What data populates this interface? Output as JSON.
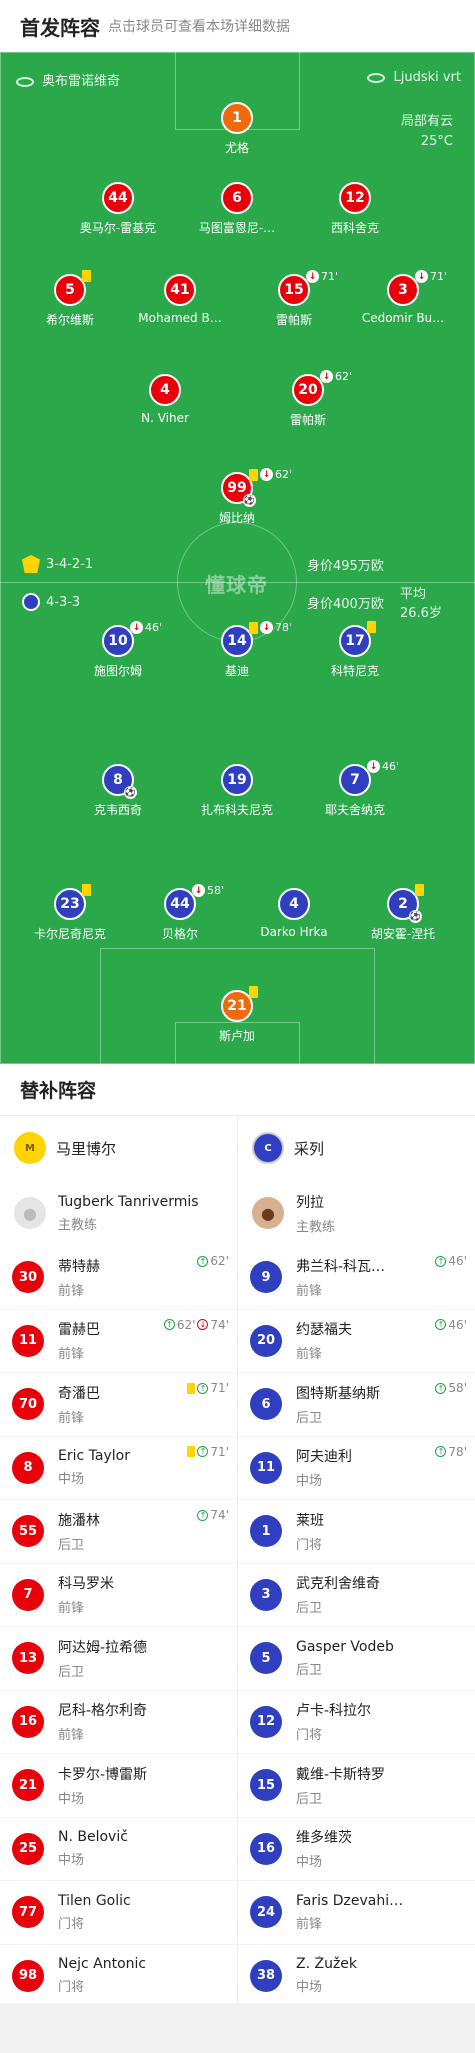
{
  "header": {
    "title": "首发阵容",
    "subtitle": "点击球员可查看本场详细数据"
  },
  "venue": {
    "home": "奥布雷诺维奇",
    "away": "Ljudski vrt"
  },
  "weather": {
    "desc": "局部有云",
    "temp": "25°C"
  },
  "watermark": "懂球帝",
  "home_team_row": {
    "formation": "3-4-2-1",
    "value": "身价495万欧"
  },
  "away_team_row": {
    "formation": "4-3-3",
    "value": "身价400万欧",
    "avg_age": "平均26.6岁"
  },
  "home_players": [
    {
      "num": "1",
      "name": "尤格",
      "color": "orange"
    },
    {
      "num": "44",
      "name": "奥马尔-雷基克",
      "color": "red"
    },
    {
      "num": "6",
      "name": "马图富恩尼-…",
      "color": "red"
    },
    {
      "num": "12",
      "name": "西科舍克",
      "color": "red"
    },
    {
      "num": "5",
      "name": "希尔维斯",
      "color": "red",
      "ev": {
        "yellow": true
      }
    },
    {
      "num": "41",
      "name": "Mohamed B…",
      "color": "red"
    },
    {
      "num": "15",
      "name": "雷帕斯",
      "color": "red",
      "ev": {
        "out": true,
        "min": "71'"
      }
    },
    {
      "num": "3",
      "name": "Cedomir Bu…",
      "color": "red",
      "ev": {
        "out": true,
        "min": "71'"
      }
    },
    {
      "num": "4",
      "name": "N. Viher",
      "color": "red"
    },
    {
      "num": "20",
      "name": "雷帕斯",
      "color": "red",
      "ev": {
        "out": true,
        "min": "62'"
      }
    },
    {
      "num": "99",
      "name": "姆比纳",
      "color": "red",
      "ev": {
        "yellow": true,
        "out": true,
        "min": "62'"
      },
      "goal": true
    }
  ],
  "away_players": [
    {
      "num": "10",
      "name": "施图尔姆",
      "color": "blue",
      "ev": {
        "out": true,
        "min": "46'"
      }
    },
    {
      "num": "14",
      "name": "基迪",
      "color": "blue",
      "ev": {
        "yellow": true,
        "out": true,
        "min": "78'"
      }
    },
    {
      "num": "17",
      "name": "科特尼克",
      "color": "blue",
      "ev": {
        "yellow": true
      }
    },
    {
      "num": "8",
      "name": "克韦西奇",
      "color": "blue",
      "goal": true
    },
    {
      "num": "19",
      "name": "扎布科夫尼克",
      "color": "blue"
    },
    {
      "num": "7",
      "name": "耶夫舍纳克",
      "color": "blue",
      "ev": {
        "out": true,
        "min": "46'"
      }
    },
    {
      "num": "23",
      "name": "卡尔尼奇尼克",
      "color": "blue",
      "ev": {
        "yellow": true
      }
    },
    {
      "num": "44",
      "name": "贝格尔",
      "color": "blue",
      "ev": {
        "out": true,
        "min": "58'"
      }
    },
    {
      "num": "4",
      "name": "Darko Hrka",
      "color": "blue"
    },
    {
      "num": "2",
      "name": "胡安霍-涅托",
      "color": "blue",
      "ev": {
        "yellow": true
      },
      "goal": true
    },
    {
      "num": "21",
      "name": "斯卢加",
      "color": "orange",
      "ev": {
        "yellow": true
      }
    }
  ],
  "subs": {
    "title": "替补阵容",
    "home": {
      "team": "马里博尔",
      "coach": {
        "name": "Tugberk Tanrivermis",
        "role": "主教练"
      },
      "players": [
        {
          "num": "30",
          "name": "蒂特赫",
          "pos": "前锋",
          "ev": "62'",
          "in": true
        },
        {
          "num": "11",
          "name": "雷赫巴",
          "pos": "前锋",
          "ev": "62'",
          "ev2": "74'",
          "in": true,
          "out": true
        },
        {
          "num": "70",
          "name": "奇潘巴",
          "pos": "前锋",
          "ev": "71'",
          "in": true,
          "yellow": true
        },
        {
          "num": "8",
          "name": "Eric Taylor",
          "pos": "中场",
          "ev": "71'",
          "in": true,
          "yellow": true
        },
        {
          "num": "55",
          "name": "施潘林",
          "pos": "后卫",
          "ev": "74'",
          "in": true
        },
        {
          "num": "7",
          "name": "科马罗米",
          "pos": "前锋"
        },
        {
          "num": "13",
          "name": "阿达姆-拉希德",
          "pos": "后卫"
        },
        {
          "num": "16",
          "name": "尼科-格尔利奇",
          "pos": "前锋"
        },
        {
          "num": "21",
          "name": "卡罗尔-博雷斯",
          "pos": "中场"
        },
        {
          "num": "25",
          "name": "N. Belovič",
          "pos": "中场"
        },
        {
          "num": "77",
          "name": "Tilen Golic",
          "pos": "门将"
        },
        {
          "num": "98",
          "name": "Nejc Antonic",
          "pos": "门将"
        }
      ]
    },
    "away": {
      "team": "采列",
      "coach": {
        "name": "列拉",
        "role": "主教练"
      },
      "players": [
        {
          "num": "9",
          "name": "弗兰科-科瓦…",
          "pos": "前锋",
          "ev": "46'",
          "in": true
        },
        {
          "num": "20",
          "name": "约瑟福夫",
          "pos": "前锋",
          "ev": "46'",
          "in": true
        },
        {
          "num": "6",
          "name": "图特斯基纳斯",
          "pos": "后卫",
          "ev": "58'",
          "in": true
        },
        {
          "num": "11",
          "name": "阿夫迪利",
          "pos": "中场",
          "ev": "78'",
          "in": true
        },
        {
          "num": "1",
          "name": "莱班",
          "pos": "门将"
        },
        {
          "num": "3",
          "name": "武克利舍维奇",
          "pos": "后卫"
        },
        {
          "num": "5",
          "name": "Gasper Vodeb",
          "pos": "后卫"
        },
        {
          "num": "12",
          "name": "卢卡-科拉尔",
          "pos": "门将"
        },
        {
          "num": "15",
          "name": "戴维-卡斯特罗",
          "pos": "后卫"
        },
        {
          "num": "16",
          "name": "维多维茨",
          "pos": "中场"
        },
        {
          "num": "24",
          "name": "Faris Dzevahi…",
          "pos": "前锋"
        },
        {
          "num": "38",
          "name": "Z. Žužek",
          "pos": "中场"
        }
      ]
    }
  }
}
